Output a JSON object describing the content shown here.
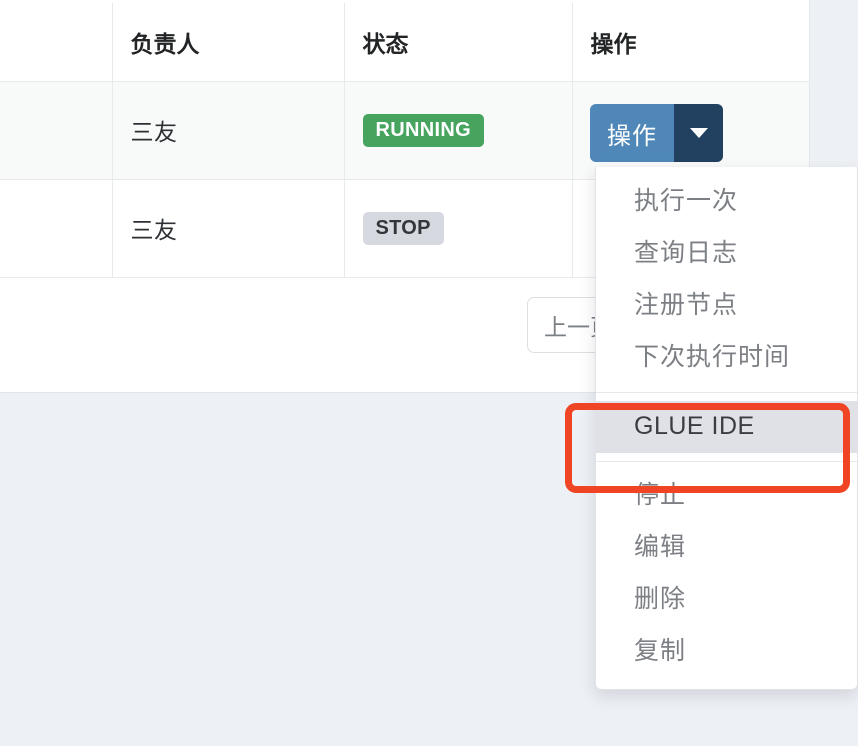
{
  "table": {
    "columns": [
      {
        "key": "spacer",
        "label": ""
      },
      {
        "key": "owner",
        "label": "负责人"
      },
      {
        "key": "status",
        "label": "状态"
      },
      {
        "key": "operation",
        "label": "操作"
      }
    ],
    "rows": [
      {
        "spacer": "",
        "owner": "三友",
        "status": "RUNNING",
        "status_kind": "running"
      },
      {
        "spacer": "",
        "owner": "三友",
        "status": "STOP",
        "status_kind": "stop"
      }
    ]
  },
  "action_button": {
    "label": "操作",
    "caret_icon": "chevron-down-icon",
    "fill_color": "#4f88b8",
    "caret_fill_color": "#22405f"
  },
  "pagination": {
    "prev_label": "上一页"
  },
  "dropdown": {
    "items": [
      {
        "label": "执行一次",
        "highlighted": false
      },
      {
        "label": "查询日志",
        "highlighted": false
      },
      {
        "label": "注册节点",
        "highlighted": false
      },
      {
        "label": "下次执行时间",
        "highlighted": false
      },
      {
        "label": "GLUE IDE",
        "highlighted": true
      },
      {
        "label": "停止",
        "highlighted": false
      },
      {
        "label": "编辑",
        "highlighted": false
      },
      {
        "label": "删除",
        "highlighted": false
      },
      {
        "label": "复制",
        "highlighted": false
      }
    ]
  },
  "annotation": {
    "target_label": "GLUE IDE",
    "color": "#ef4524"
  },
  "colors": {
    "page_background": "#edf0f5",
    "card_background": "#ffffff",
    "badge_running": "#46a45f",
    "badge_stop": "#d6d9e0",
    "row_stripe": "#f8f9f9",
    "menu_text": "#7c7f84",
    "menu_highlight": "#dfe1e6"
  }
}
